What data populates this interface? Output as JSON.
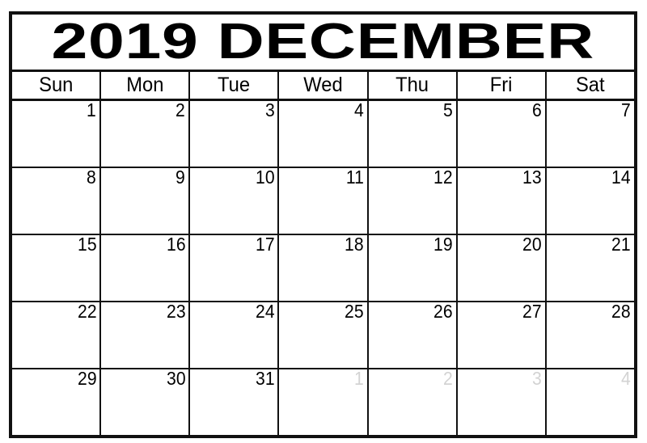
{
  "calendar": {
    "title": "2019 DECEMBER",
    "year": "2019",
    "month": "DECEMBER",
    "weekday_headers": [
      {
        "label": "Sun"
      },
      {
        "label": "Mon"
      },
      {
        "label": "Tue"
      },
      {
        "label": "Wed"
      },
      {
        "label": "Thu"
      },
      {
        "label": "Fri"
      },
      {
        "label": "Sat"
      }
    ],
    "colors": {
      "border": "#111111",
      "background": "#ffffff",
      "current_month_text": "#000000",
      "outside_month_text": "#d3d3d3"
    },
    "weeks": [
      {
        "days": [
          {
            "number": "1",
            "outside": false
          },
          {
            "number": "2",
            "outside": false
          },
          {
            "number": "3",
            "outside": false
          },
          {
            "number": "4",
            "outside": false
          },
          {
            "number": "5",
            "outside": false
          },
          {
            "number": "6",
            "outside": false
          },
          {
            "number": "7",
            "outside": false
          }
        ]
      },
      {
        "days": [
          {
            "number": "8",
            "outside": false
          },
          {
            "number": "9",
            "outside": false
          },
          {
            "number": "10",
            "outside": false
          },
          {
            "number": "11",
            "outside": false
          },
          {
            "number": "12",
            "outside": false
          },
          {
            "number": "13",
            "outside": false
          },
          {
            "number": "14",
            "outside": false
          }
        ]
      },
      {
        "days": [
          {
            "number": "15",
            "outside": false
          },
          {
            "number": "16",
            "outside": false
          },
          {
            "number": "17",
            "outside": false
          },
          {
            "number": "18",
            "outside": false
          },
          {
            "number": "19",
            "outside": false
          },
          {
            "number": "20",
            "outside": false
          },
          {
            "number": "21",
            "outside": false
          }
        ]
      },
      {
        "days": [
          {
            "number": "22",
            "outside": false
          },
          {
            "number": "23",
            "outside": false
          },
          {
            "number": "24",
            "outside": false
          },
          {
            "number": "25",
            "outside": false
          },
          {
            "number": "26",
            "outside": false
          },
          {
            "number": "27",
            "outside": false
          },
          {
            "number": "28",
            "outside": false
          }
        ]
      },
      {
        "days": [
          {
            "number": "29",
            "outside": false
          },
          {
            "number": "30",
            "outside": false
          },
          {
            "number": "31",
            "outside": false
          },
          {
            "number": "1",
            "outside": true
          },
          {
            "number": "2",
            "outside": true
          },
          {
            "number": "3",
            "outside": true
          },
          {
            "number": "4",
            "outside": true
          }
        ]
      }
    ]
  }
}
